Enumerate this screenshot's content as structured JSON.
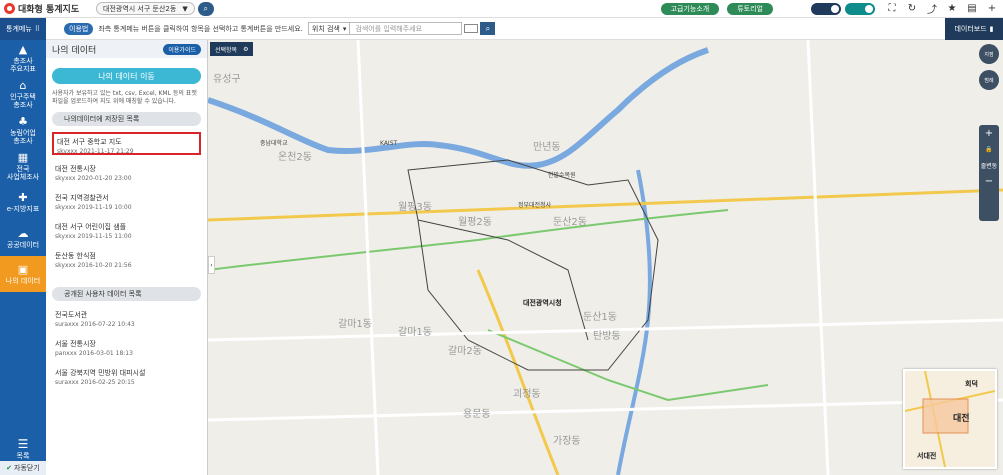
{
  "app": {
    "title": "대화형 통계지도"
  },
  "header": {
    "region": "대전광역시 서구 둔산2동",
    "buttons": [
      "고급기능소개",
      "튜토리얼"
    ],
    "icons": [
      "fullscreen-icon",
      "refresh-icon",
      "share-icon",
      "star-icon",
      "report-icon",
      "plus-icon"
    ]
  },
  "subbar": {
    "usage_label": "이용법",
    "hint": "좌측 통계메뉴 버튼을 클릭하여 항목을 선택하고 통계버튼을 만드세요.",
    "search_type": "위치 검색",
    "search_placeholder": "검색어를 입력해주세요",
    "dashboard_label": "데이터보드"
  },
  "nav": {
    "head": "통계메뉴",
    "items": [
      {
        "label": "총조사\n주요지표",
        "icon": "chart-icon"
      },
      {
        "label": "인구주택\n총조사",
        "icon": "house-icon"
      },
      {
        "label": "농림어업\n총조사",
        "icon": "farm-icon"
      },
      {
        "label": "전국\n사업체조사",
        "icon": "building-icon"
      },
      {
        "label": "e-지방지표",
        "icon": "region-icon"
      },
      {
        "label": "공공데이터",
        "icon": "cloud-icon"
      },
      {
        "label": "나의 데이터",
        "icon": "user-data-icon"
      }
    ],
    "list_label": "목록",
    "auto_close": "자동닫기"
  },
  "panel": {
    "title": "나의 데이터",
    "guide": "이용가이드",
    "move_btn": "나의 데이터 이동",
    "desc": "사용자가 보유하고 있는 txt, csv, Excel, KML 등의 표맷파일을 업로드하여 지도 위에 매칭할 수 있습니다.",
    "saved_header": "나의데이터에 저장된 목록",
    "saved": [
      {
        "title": "대전 서구 중학교 지도",
        "meta": "skyxxx 2021-11-17 21:29"
      },
      {
        "title": "대전 전통시장",
        "meta": "skyxxx 2020-01-20 23:00"
      },
      {
        "title": "전국 지역경찰관서",
        "meta": "skyxxx 2019-11-19 10:00"
      },
      {
        "title": "대전 서구 어린이집 샘플",
        "meta": "skyxxx 2019-11-15 11:00"
      },
      {
        "title": "둔산동 한식점",
        "meta": "skyxxx 2016-10-20 21:56"
      }
    ],
    "shared_header": "공개된 사용자 데이터 목록",
    "shared": [
      {
        "title": "전국도서관",
        "meta": "suraxxx 2016-07-22 10:43"
      },
      {
        "title": "서울 전통시장",
        "meta": "panxxx 2016-03-01 18:13"
      },
      {
        "title": "서울 강북지역 민방위 대피시설",
        "meta": "suraxxx 2016-02-25 20:15"
      }
    ]
  },
  "map": {
    "sel_area": "선택항목",
    "labels": [
      "유성구",
      "온천2동",
      "만년동",
      "월평3동",
      "월평2동",
      "둔산2동",
      "둔산1동",
      "갈마1동",
      "갈마2동",
      "갈마1동",
      "탄방동",
      "괴정동",
      "가장동",
      "용문동",
      "대전광역시청",
      "정부대전청사",
      "KAIST",
      "충남대학교",
      "한밭수목원",
      "대전",
      "서대전",
      "회덕"
    ],
    "rt": [
      "지점",
      "범례"
    ],
    "zoom": [
      "+",
      "−",
      "줄변동"
    ]
  }
}
